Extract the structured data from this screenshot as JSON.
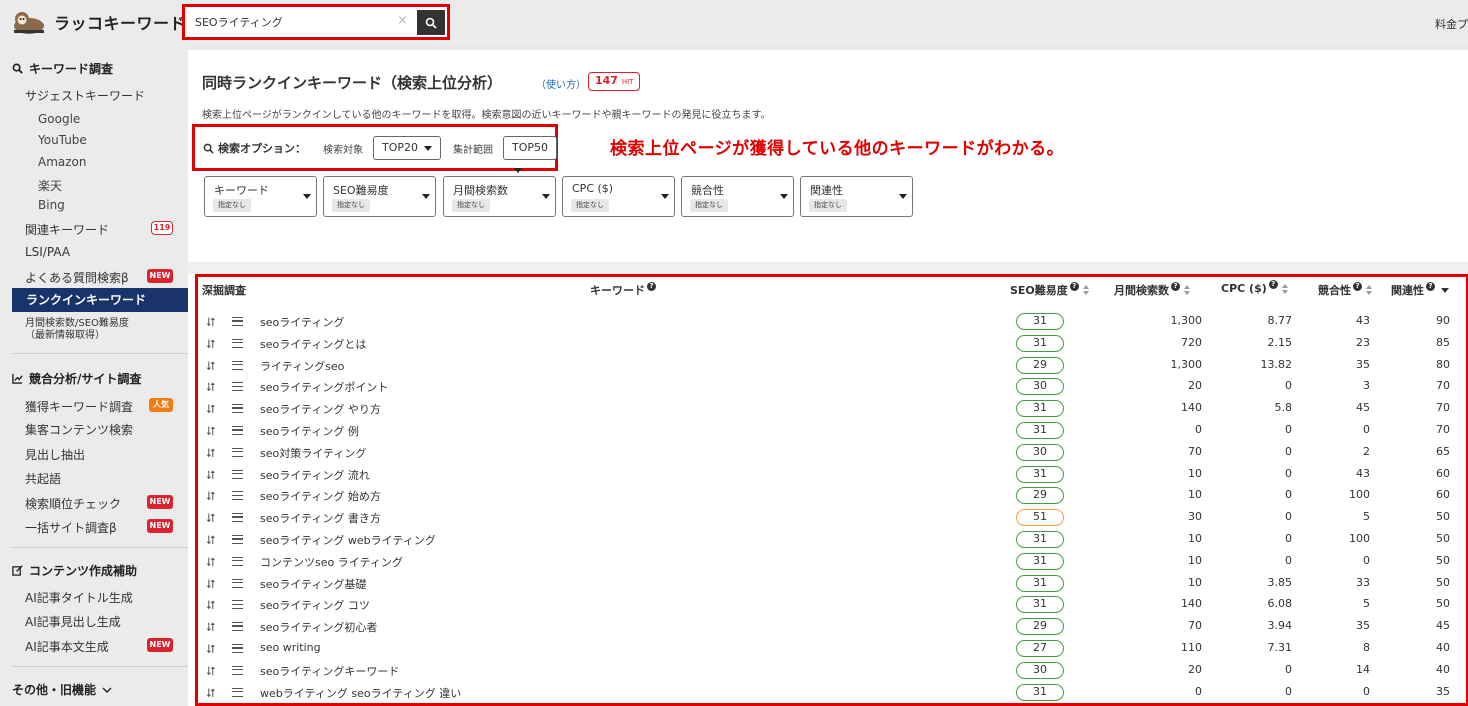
{
  "app": {
    "name": "ラッコキーワード",
    "top_right": "料金プ"
  },
  "search": {
    "value": "SEOライティング",
    "clear_glyph": "×"
  },
  "sidebar": {
    "keyword_section": "キーワード調査",
    "suggest": "サジェストキーワード",
    "sources": [
      "Google",
      "YouTube",
      "Amazon",
      "楽天",
      "Bing"
    ],
    "related": "関連キーワード",
    "related_count": "119",
    "lsi": "LSI/PAA",
    "faq": "よくある質問検索β",
    "rankin": "ランクインキーワード",
    "monthly_line1": "月間検索数/SEO難易度",
    "monthly_line2": "（最新情報取得）",
    "competitor_section": "競合分析/サイト調査",
    "acquired": "獲得キーワード調査",
    "acquired_badge": "人気",
    "content_search": "集客コンテンツ検索",
    "heading_extract": "見出し抽出",
    "cooccur": "共起語",
    "rank_check": "検索順位チェック",
    "bulk_site": "一括サイト調査β",
    "content_section": "コンテンツ作成補助",
    "ai_title": "AI記事タイトル生成",
    "ai_heading": "AI記事見出し生成",
    "ai_body": "AI記事本文生成",
    "other_section": "その他・旧機能",
    "new_badge": "NEW"
  },
  "main": {
    "title": "同時ランクインキーワード（検索上位分析）",
    "howto": "（使い方）",
    "hit_count": "147",
    "hit_label": "HIT",
    "description": "検索上位ページがランクインしている他のキーワードを取得。検索意図の近いキーワードや親キーワードの発見に役立ちます。",
    "options_label": "検索オプション：",
    "target_label": "検索対象",
    "target_value": "TOP20",
    "range_label": "集計範囲",
    "range_value": "TOP50",
    "annotation": "検索上位ページが獲得している他のキーワードがわかる。",
    "filters": [
      {
        "name": "キーワード",
        "chip": "指定なし"
      },
      {
        "name": "SEO難易度",
        "chip": "指定なし"
      },
      {
        "name": "月間検索数",
        "chip": "指定なし"
      },
      {
        "name": "CPC ($)",
        "chip": "指定なし"
      },
      {
        "name": "競合性",
        "chip": "指定なし"
      },
      {
        "name": "関連性",
        "chip": "指定なし"
      }
    ]
  },
  "table": {
    "headers": {
      "dig": "深掘調査",
      "keyword": "キーワード",
      "seo": "SEO難易度",
      "volume": "月間検索数",
      "cpc": "CPC ($)",
      "competition": "競合性",
      "relevance": "関連性"
    },
    "rows": [
      {
        "keyword": "seoライティング",
        "seo": "31",
        "volume": "1,300",
        "cpc": "8.77",
        "competition": "43",
        "relevance": "90"
      },
      {
        "keyword": "seoライティングとは",
        "seo": "31",
        "volume": "720",
        "cpc": "2.15",
        "competition": "23",
        "relevance": "85"
      },
      {
        "keyword": "ライティングseo",
        "seo": "29",
        "volume": "1,300",
        "cpc": "13.82",
        "competition": "35",
        "relevance": "80"
      },
      {
        "keyword": "seoライティングポイント",
        "seo": "30",
        "volume": "20",
        "cpc": "0",
        "competition": "3",
        "relevance": "70"
      },
      {
        "keyword": "seoライティング やり方",
        "seo": "31",
        "volume": "140",
        "cpc": "5.8",
        "competition": "45",
        "relevance": "70"
      },
      {
        "keyword": "seoライティング 例",
        "seo": "31",
        "volume": "0",
        "cpc": "0",
        "competition": "0",
        "relevance": "70"
      },
      {
        "keyword": "seo対策ライティング",
        "seo": "30",
        "volume": "70",
        "cpc": "0",
        "competition": "2",
        "relevance": "65"
      },
      {
        "keyword": "seoライティング 流れ",
        "seo": "31",
        "volume": "10",
        "cpc": "0",
        "competition": "43",
        "relevance": "60"
      },
      {
        "keyword": "seoライティング 始め方",
        "seo": "29",
        "volume": "10",
        "cpc": "0",
        "competition": "100",
        "relevance": "60"
      },
      {
        "keyword": "seoライティング 書き方",
        "seo": "51",
        "volume": "30",
        "cpc": "0",
        "competition": "5",
        "relevance": "50"
      },
      {
        "keyword": "seoライティング webライティング",
        "seo": "31",
        "volume": "10",
        "cpc": "0",
        "competition": "100",
        "relevance": "50"
      },
      {
        "keyword": "コンテンツseo ライティング",
        "seo": "31",
        "volume": "10",
        "cpc": "0",
        "competition": "0",
        "relevance": "50"
      },
      {
        "keyword": "seoライティング基礎",
        "seo": "31",
        "volume": "10",
        "cpc": "3.85",
        "competition": "33",
        "relevance": "50"
      },
      {
        "keyword": "seoライティング コツ",
        "seo": "31",
        "volume": "140",
        "cpc": "6.08",
        "competition": "5",
        "relevance": "50"
      },
      {
        "keyword": "seoライティング初心者",
        "seo": "29",
        "volume": "70",
        "cpc": "3.94",
        "competition": "35",
        "relevance": "45"
      },
      {
        "keyword": "seo writing",
        "seo": "27",
        "volume": "110",
        "cpc": "7.31",
        "competition": "8",
        "relevance": "40"
      },
      {
        "keyword": "seoライティングキーワード",
        "seo": "30",
        "volume": "20",
        "cpc": "0",
        "competition": "14",
        "relevance": "40"
      },
      {
        "keyword": "webライティング seoライティング 違い",
        "seo": "31",
        "volume": "0",
        "cpc": "0",
        "competition": "0",
        "relevance": "35"
      }
    ]
  },
  "colors": {
    "accent_red": "#e00000",
    "nav_active": "#17346b",
    "seo_green": "#4a9a45",
    "seo_orange": "#f0a040"
  }
}
